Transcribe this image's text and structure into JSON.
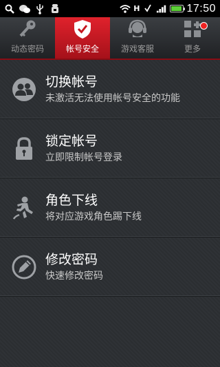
{
  "status_bar": {
    "time": "17:50",
    "icons": [
      "search-icon",
      "wechat-icon",
      "usb-icon",
      "android-debug-icon",
      "wifi-icon",
      "data-h-icon",
      "signal-icon",
      "battery-icon"
    ],
    "data_type": "H",
    "battery_level": 0.9
  },
  "tabs": [
    {
      "label": "动态密码",
      "icon": "key-icon",
      "active": false
    },
    {
      "label": "帐号安全",
      "icon": "shield-check-icon",
      "active": true
    },
    {
      "label": "游戏客服",
      "icon": "headset-icon",
      "active": false
    },
    {
      "label": "更多",
      "icon": "grid-plus-icon",
      "active": false,
      "badge": true
    }
  ],
  "colors": {
    "accent": "#d41b24",
    "background": "#2b2e31",
    "text_primary": "#ffffff",
    "text_secondary": "#c9c9c9"
  },
  "menu": [
    {
      "title": "切换帐号",
      "subtitle": "未激活无法使用帐号安全的功能",
      "icon": "switch-account-icon"
    },
    {
      "title": "锁定帐号",
      "subtitle": "立即限制帐号登录",
      "icon": "lock-icon"
    },
    {
      "title": "角色下线",
      "subtitle": "将对应游戏角色踢下线",
      "icon": "kick-character-icon"
    },
    {
      "title": "修改密码",
      "subtitle": "快速修改密码",
      "icon": "edit-password-icon"
    }
  ]
}
